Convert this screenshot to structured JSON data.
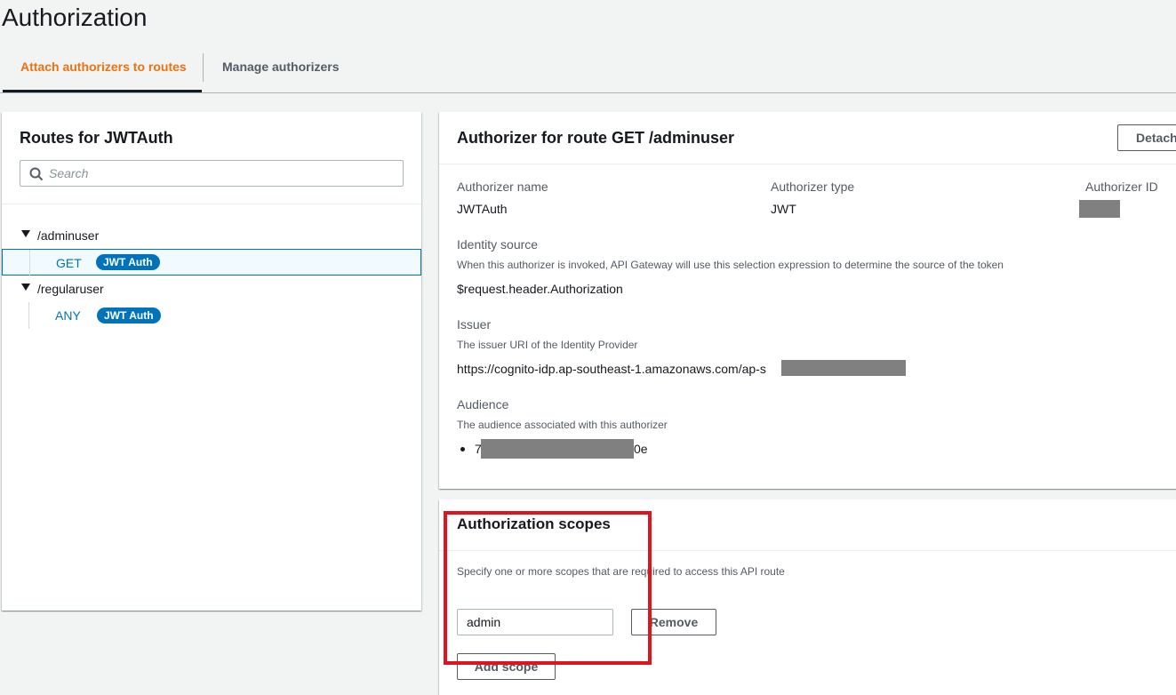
{
  "page": {
    "title": "Authorization"
  },
  "tabs": [
    {
      "label": "Attach authorizers to routes",
      "active": true
    },
    {
      "label": "Manage authorizers",
      "active": false
    }
  ],
  "routes_panel": {
    "title": "Routes for JWTAuth",
    "search_placeholder": "Search",
    "routes": [
      {
        "path": "/adminuser",
        "method": "GET",
        "badge": "JWT Auth",
        "selected": true
      },
      {
        "path": "/regularuser",
        "method": "ANY",
        "badge": "JWT Auth",
        "selected": false
      }
    ]
  },
  "authorizer_panel": {
    "title": "Authorizer for route GET /adminuser",
    "detach_label": "Detach",
    "name_label": "Authorizer name",
    "name_value": "JWTAuth",
    "type_label": "Authorizer type",
    "type_value": "JWT",
    "id_label": "Authorizer ID",
    "identity_label": "Identity source",
    "identity_desc": "When this authorizer is invoked, API Gateway will use this selection expression to determine the source of the token",
    "identity_value": "$request.header.Authorization",
    "issuer_label": "Issuer",
    "issuer_desc": "The issuer URI of the Identity Provider",
    "issuer_value": "https://cognito-idp.ap-southeast-1.amazonaws.com/ap-s",
    "audience_label": "Audience",
    "audience_desc": "The audience associated with this authorizer",
    "audience_prefix": "7",
    "audience_suffix": "0e"
  },
  "scopes_panel": {
    "title": "Authorization scopes",
    "desc": "Specify one or more scopes that are required to access this API route",
    "scope_value": "admin",
    "remove_label": "Remove",
    "add_label": "Add scope"
  },
  "colors": {
    "accent": "#ec7211",
    "link": "#0073bb",
    "highlight": "#e0141e"
  }
}
